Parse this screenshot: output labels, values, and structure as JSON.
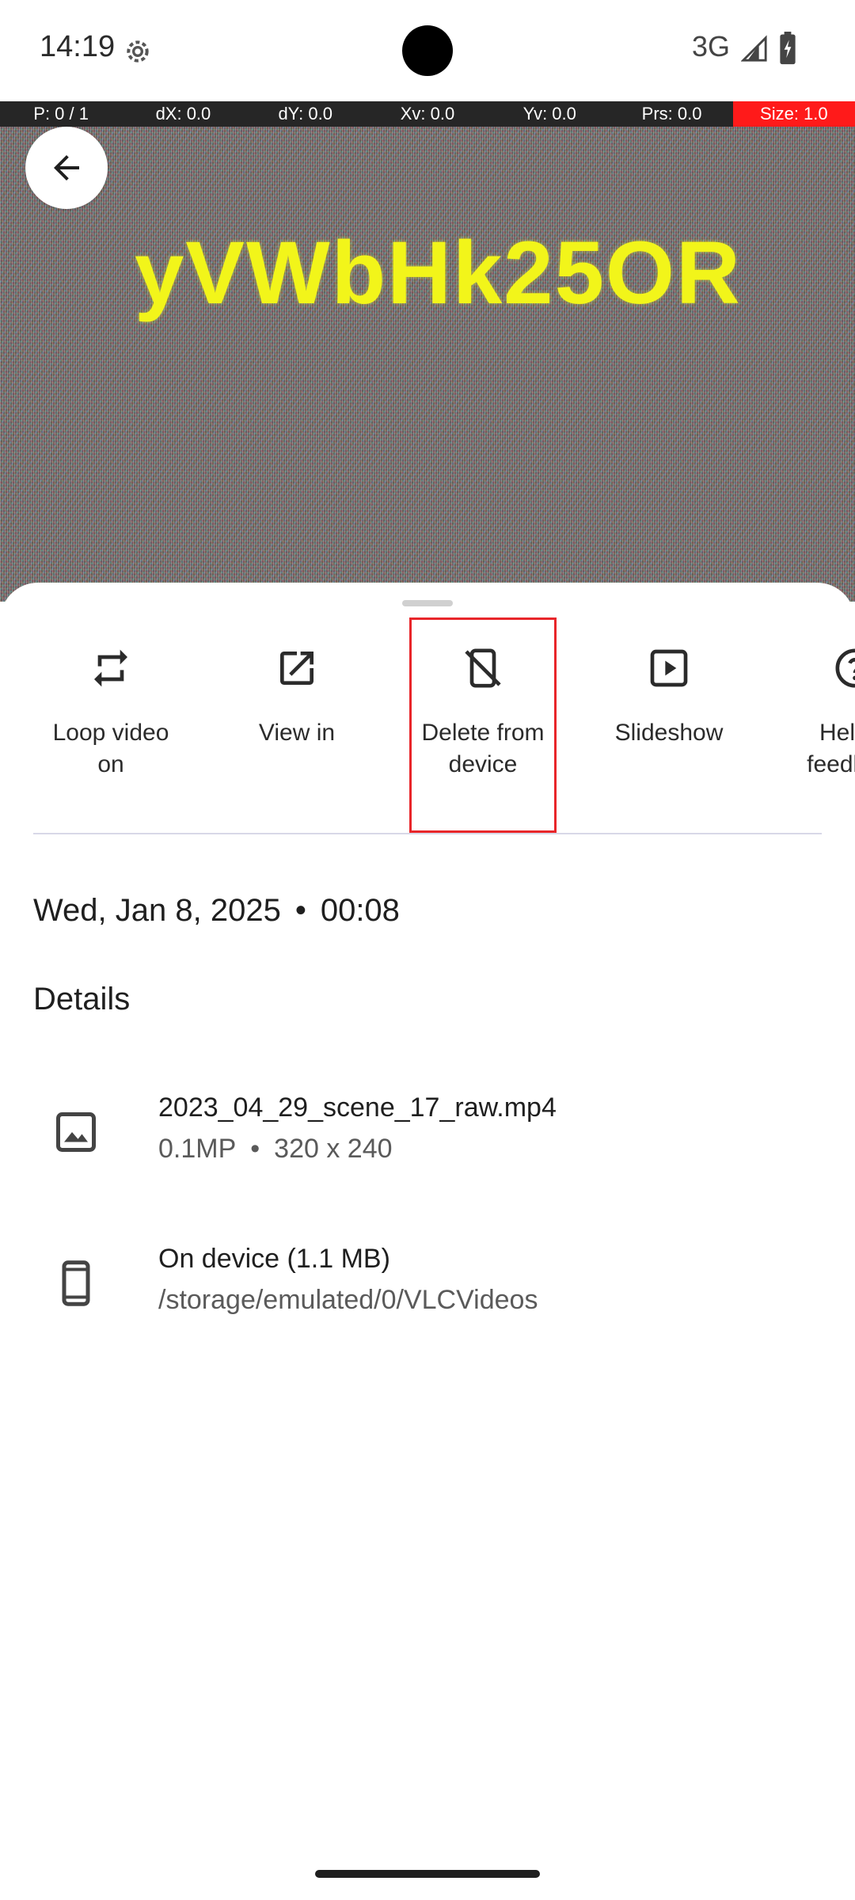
{
  "status_bar": {
    "time": "14:19",
    "network": "3G",
    "icons": [
      "settings-gear-icon",
      "signal-icon",
      "battery-icon"
    ]
  },
  "pointer_overlay": {
    "p": "P: 0 / 1",
    "dx": "dX: 0.0",
    "dy": "dY: 0.0",
    "xv": "Xv: 0.0",
    "yv": "Yv: 0.0",
    "prs": "Prs: 0.0",
    "size": "Size: 1.0"
  },
  "media": {
    "overlay_text": "yVWbHk25OR"
  },
  "actions": [
    {
      "label": "Loop video on",
      "icon": "loop-icon"
    },
    {
      "label": "View in",
      "icon": "open-external-icon"
    },
    {
      "label": "Delete from device",
      "icon": "delete-from-device-icon"
    },
    {
      "label": "Slideshow",
      "icon": "slideshow-icon"
    },
    {
      "label": "Help & feedback",
      "icon": "help-icon"
    }
  ],
  "date": {
    "day": "Wed, Jan 8, 2025",
    "separator": "•",
    "time": "00:08"
  },
  "details": {
    "title": "Details",
    "file": {
      "name": "2023_04_29_scene_17_raw.mp4",
      "megapixels": "0.1MP",
      "separator": "•",
      "resolution": "320 x 240"
    },
    "storage": {
      "location": "On device (1.1 MB)",
      "path": "/storage/emulated/0/VLCVideos"
    }
  },
  "colors": {
    "highlight": "#e8262a",
    "overlay_text": "#f2f51a",
    "pointer_size_bg": "#ff1a1a"
  }
}
